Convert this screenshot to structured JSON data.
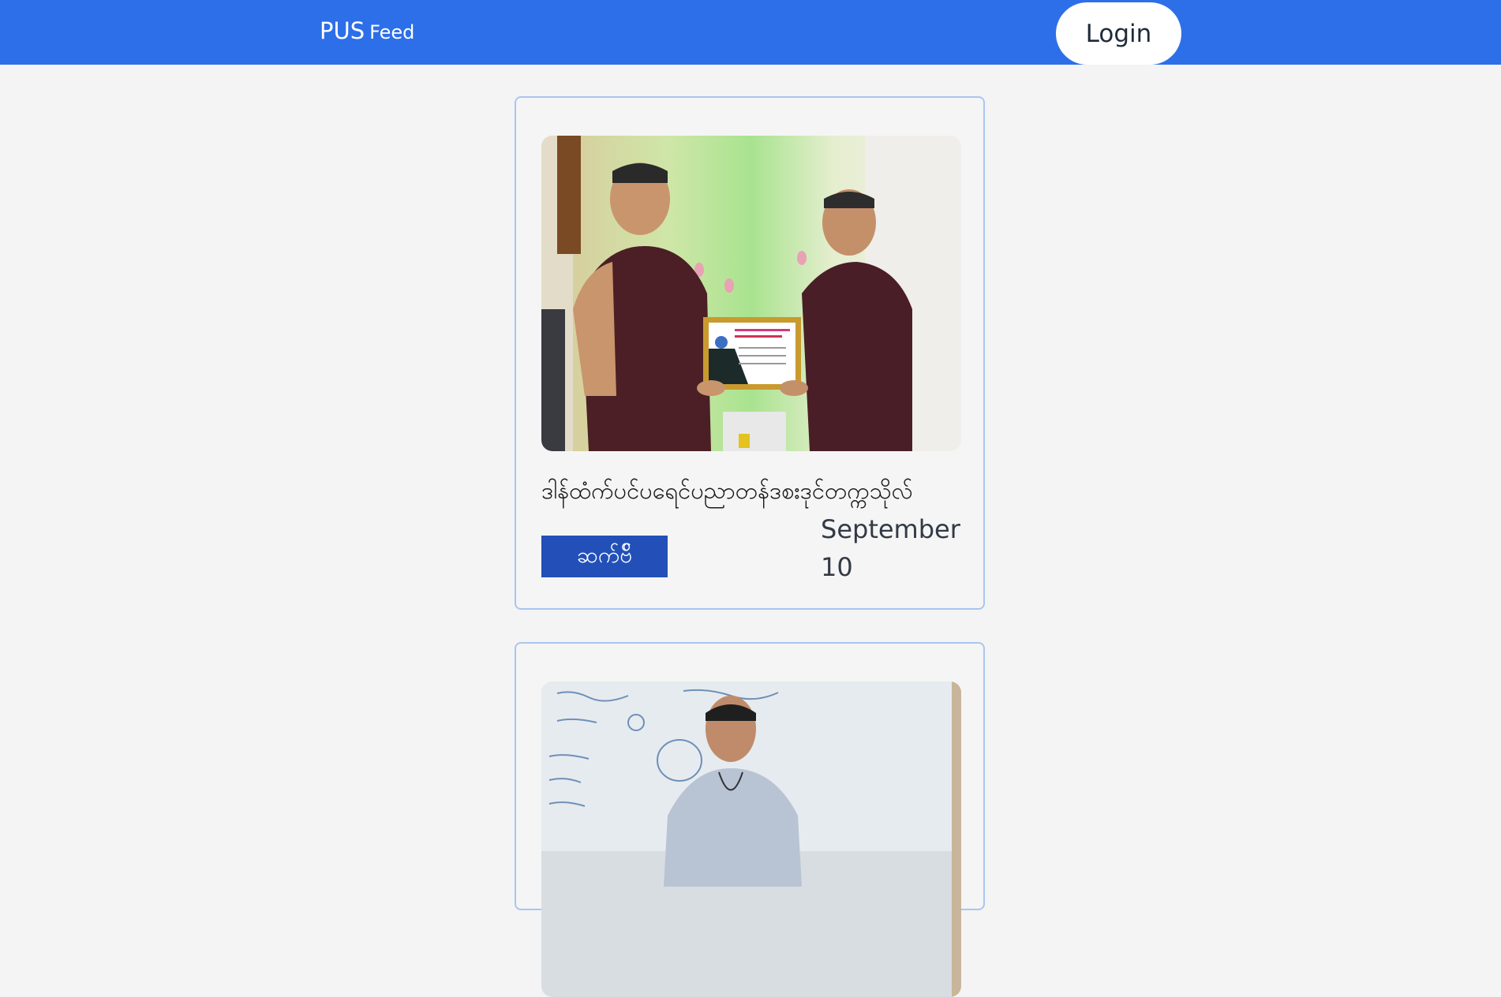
{
  "navbar": {
    "brand_main": "PUS",
    "brand_sub": "Feed",
    "login_label": "Login"
  },
  "posts": [
    {
      "title": "ဒါန်ထံက်ပင်ပရေင်ပညာတန်ဒစးဒုင်တက္ကသိုလ်",
      "button_label": "ဆက်ဗ်ိ",
      "date": "September 10",
      "image_desc_icon": "photo-two-monks-certificate"
    },
    {
      "image_desc_icon": "photo-lecturer-whiteboard"
    }
  ],
  "colors": {
    "navbar_bg": "#2d6fe8",
    "page_bg": "#f4f4f4",
    "card_border": "#a8c6ef",
    "button_bg": "#2350b8"
  }
}
